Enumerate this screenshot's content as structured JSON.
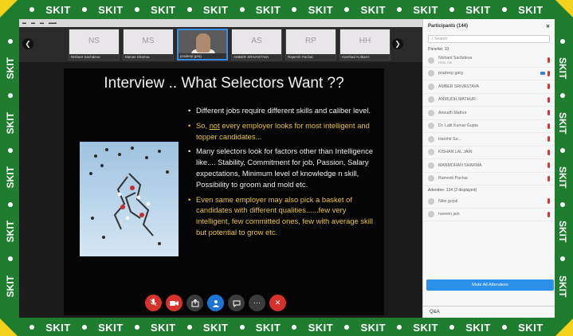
{
  "border": {
    "word": "SKIT",
    "colors": {
      "green": "#1f7d30",
      "yellow": "#f3d21b"
    }
  },
  "thumbnails": [
    {
      "initials": "NS",
      "name": "Nishant Sachdeva"
    },
    {
      "initials": "MS",
      "name": "Manas Sharma"
    },
    {
      "initials": "",
      "name": "pradeep garg",
      "active": true
    },
    {
      "initials": "AS",
      "name": "AMBER SRIVASTAVA"
    },
    {
      "initials": "RP",
      "name": "Rajeesh Pachai"
    },
    {
      "initials": "HH",
      "name": "Harshad Kulkarni"
    }
  ],
  "slide": {
    "title": "Interview .. What Selectors Want ??",
    "bullets": [
      {
        "text": "Different jobs require different skills and caliber level.",
        "color": "white"
      },
      {
        "pre": "So, ",
        "underline": "not",
        "post": " every employer looks for most intelligent and topper candidates...",
        "color": "yellow"
      },
      {
        "text": "Many selectors look for factors other than Intelligence like.... Stability, Commitment for job, Passion, Salary expectations, Minimum level of knowledge n skill, Possibility to groom and mold etc.",
        "color": "white"
      },
      {
        "text": "Even same employer may also pick a basket of candidates with different qualities......few very intelligent, few committed ones, few with average skill but potential to grow etc.",
        "color": "yellow"
      }
    ]
  },
  "controls": [
    "mic-off",
    "video-off",
    "share",
    "participants",
    "chat",
    "more",
    "leave"
  ],
  "panel": {
    "title": "Participants (144)",
    "search_placeholder": "Search",
    "panelists_label": "Panelist: 10",
    "panelists": [
      {
        "name": "Nishant Sachdeva",
        "sub": "Host, me"
      },
      {
        "name": "pradeep garg",
        "video": true
      },
      {
        "name": "AMBER SRIVASTAVA"
      },
      {
        "name": "ANIRUDH MATHUR"
      },
      {
        "name": "Anirudh Mathur"
      },
      {
        "name": "Dr. Lalit Kumar Gupta"
      },
      {
        "name": "Harshit Sa..."
      },
      {
        "name": "KISHAN LAL JAIN"
      },
      {
        "name": "MANMOHAN SHARMA"
      },
      {
        "name": "Ramesh Pachai"
      }
    ],
    "attendees_label": "Attendee: 134 (2 displayed)",
    "attendees": [
      {
        "name": "Nitin goyal"
      },
      {
        "name": "naveen jain"
      }
    ],
    "mute_all_label": "Mute All Attendees",
    "qa_label": "Q&A"
  }
}
